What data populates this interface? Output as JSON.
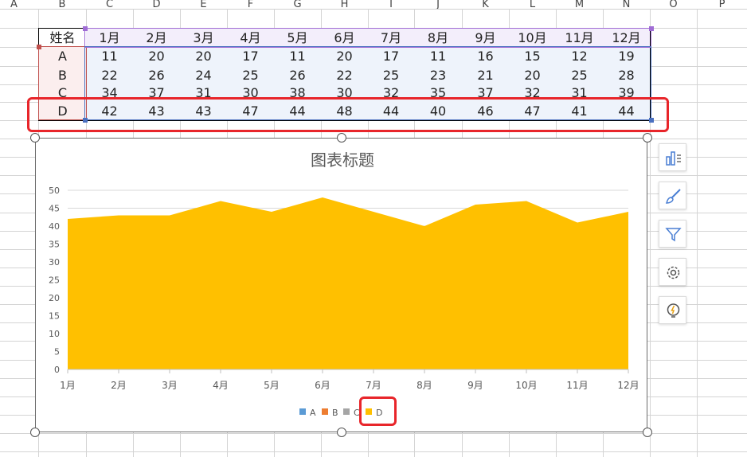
{
  "columns": [
    "A",
    "B",
    "C",
    "D",
    "E",
    "F",
    "G",
    "H",
    "I",
    "J",
    "K",
    "L",
    "M",
    "N",
    "O",
    "P"
  ],
  "table": {
    "name_header": "姓名",
    "month_headers": [
      "1月",
      "2月",
      "3月",
      "4月",
      "5月",
      "6月",
      "7月",
      "8月",
      "9月",
      "10月",
      "11月",
      "12月"
    ],
    "rows": [
      {
        "name": "A",
        "values": [
          "11",
          "20",
          "20",
          "17",
          "11",
          "20",
          "17",
          "11",
          "16",
          "15",
          "12",
          "19"
        ]
      },
      {
        "name": "B",
        "values": [
          "22",
          "26",
          "24",
          "25",
          "26",
          "22",
          "25",
          "23",
          "21",
          "20",
          "25",
          "28"
        ]
      },
      {
        "name": "C",
        "values": [
          "34",
          "37",
          "31",
          "30",
          "38",
          "30",
          "32",
          "35",
          "37",
          "32",
          "31",
          "39"
        ]
      },
      {
        "name": "D",
        "values": [
          "42",
          "43",
          "43",
          "47",
          "44",
          "48",
          "44",
          "40",
          "46",
          "47",
          "41",
          "44"
        ]
      }
    ]
  },
  "chart_data": {
    "type": "area",
    "title": "图表标题",
    "categories": [
      "1月",
      "2月",
      "3月",
      "4月",
      "5月",
      "6月",
      "7月",
      "8月",
      "9月",
      "10月",
      "11月",
      "12月"
    ],
    "ylim": [
      0,
      50
    ],
    "yticks": [
      "0",
      "5",
      "10",
      "15",
      "20",
      "25",
      "30",
      "35",
      "40",
      "45",
      "50"
    ],
    "grid": true,
    "legend_position": "bottom",
    "legend": [
      "A",
      "B",
      "C",
      "D"
    ],
    "legend_colors": [
      "#5b9bd5",
      "#ed7d31",
      "#a5a5a5",
      "#ffc000"
    ],
    "series": [
      {
        "name": "D",
        "values": [
          42,
          43,
          43,
          47,
          44,
          48,
          44,
          40,
          46,
          47,
          41,
          44
        ],
        "color": "#ffc000"
      }
    ]
  },
  "toolbar": {
    "icons": [
      "chart-elements-icon",
      "chart-style-brush-icon",
      "chart-filter-icon",
      "chart-settings-gear-icon",
      "chart-idea-bulb-icon"
    ]
  },
  "colors": {
    "highlight_red": "#e8252a",
    "selection_purple": "#a06cd5",
    "selection_blue": "#4a70c0",
    "selection_red": "#c0504d"
  }
}
